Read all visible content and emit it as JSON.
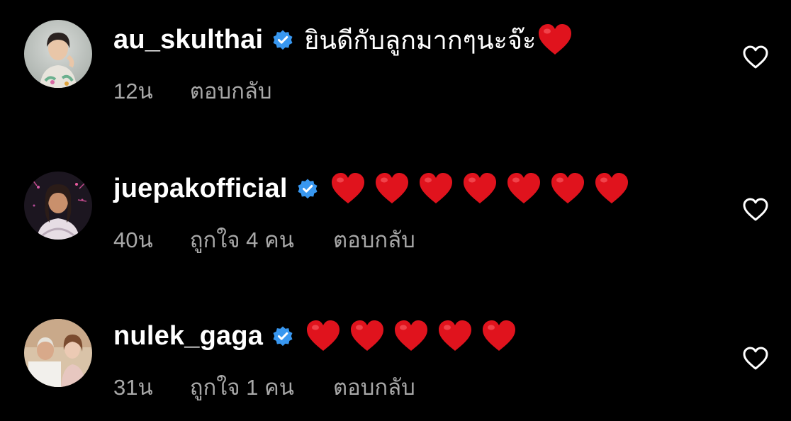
{
  "comments": [
    {
      "username": "au_skulthai",
      "verified": true,
      "text": "ยินดีกับลูกมากๆนะจ๊ะ",
      "trailing_emoji_count": 1,
      "time": "12น",
      "likes_label": "",
      "reply_label": "ตอบกลับ"
    },
    {
      "username": "juepakofficial",
      "verified": true,
      "text": "",
      "trailing_emoji_count": 7,
      "time": "40น",
      "likes_label": "ถูกใจ 4 คน",
      "reply_label": "ตอบกลับ"
    },
    {
      "username": "nulek_gaga",
      "verified": true,
      "text": "",
      "trailing_emoji_count": 5,
      "time": "31น",
      "likes_label": "ถูกใจ 1 คน",
      "reply_label": "ตอบกลับ"
    }
  ],
  "icons": {
    "verified": "verified-badge-icon",
    "emoji": "red-heart-emoji",
    "like": "heart-outline-icon"
  },
  "colors": {
    "background": "#000000",
    "text_primary": "#ffffff",
    "text_secondary": "#a8a8a8",
    "verified_blue": "#3897f0",
    "heart_red": "#e0131d"
  }
}
